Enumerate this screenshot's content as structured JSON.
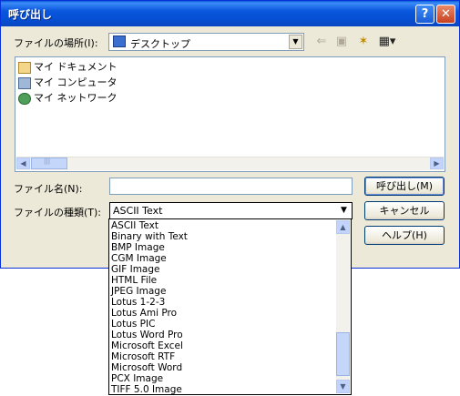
{
  "window": {
    "title": "呼び出し",
    "help_button": "?",
    "close_button": "✕"
  },
  "location": {
    "label": "ファイルの場所(I):",
    "value": "デスクトップ",
    "arrow": "▼"
  },
  "toolbar": {
    "back": "⇐",
    "up": "▣",
    "new_folder": "✶",
    "view": "▦▾"
  },
  "files": [
    {
      "name": "マイ ドキュメント",
      "icon": "folder-icon"
    },
    {
      "name": "マイ コンピュータ",
      "icon": "computer-icon"
    },
    {
      "name": "マイ ネットワーク",
      "icon": "network-icon"
    }
  ],
  "scroll": {
    "left": "◀",
    "right": "▶",
    "up": "▲",
    "down": "▼",
    "grip": "|||"
  },
  "filename": {
    "label": "ファイル名(N):",
    "value": ""
  },
  "filetype": {
    "label": "ファイルの種類(T):",
    "value": "ASCII Text",
    "arrow": "▼"
  },
  "buttons": {
    "open": "呼び出し(M)",
    "cancel": "キャンセル",
    "help": "ヘルプ(H)"
  },
  "filetype_options": [
    "ASCII Text",
    "Binary with Text",
    "BMP Image",
    "CGM Image",
    "GIF Image",
    "HTML File",
    "JPEG Image",
    "Lotus 1-2-3",
    "Lotus Ami Pro",
    "Lotus PIC",
    "Lotus Word Pro",
    "Microsoft Excel",
    "Microsoft RTF",
    "Microsoft Word",
    "PCX Image",
    "TIFF 5.0 Image"
  ]
}
